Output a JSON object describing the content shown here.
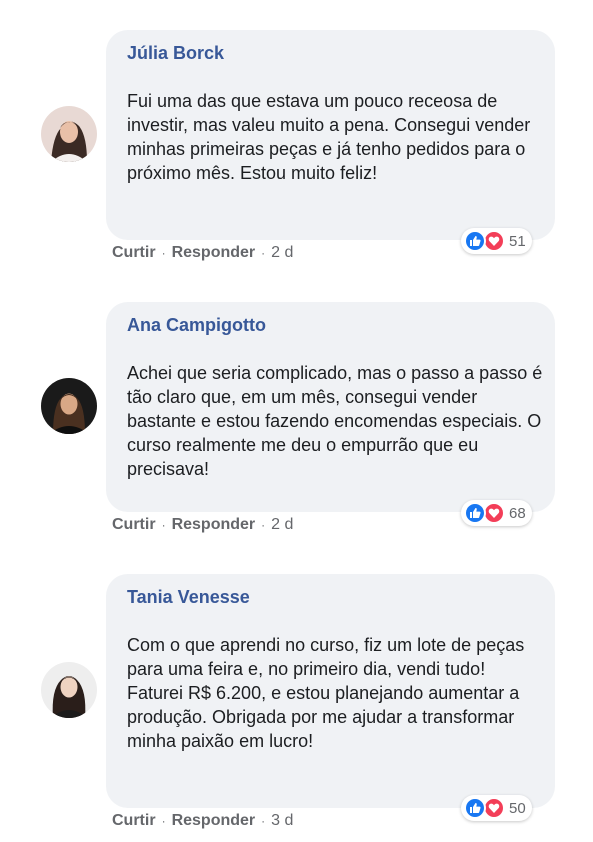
{
  "comments": [
    {
      "author": "Júlia Borck",
      "text": "Fui uma das que estava um pouco receosa de investir, mas valeu muito a pena. Consegui vender minhas primeiras peças e já tenho pedidos para o próximo mês. Estou muito feliz!",
      "reaction_count": "51",
      "like_label": "Curtir",
      "reply_label": "Responder",
      "time": "2 d"
    },
    {
      "author": "Ana Campigotto",
      "text": "Achei que seria complicado, mas o passo a passo é tão claro que, em um mês, consegui vender bastante e estou fazendo encomendas especiais. O curso realmente me deu o empurrão que eu precisava!",
      "reaction_count": "68",
      "like_label": "Curtir",
      "reply_label": "Responder",
      "time": "2 d"
    },
    {
      "author": "Tania Venesse",
      "text": "Com o que aprendi no curso, fiz um lote de peças para uma feira e, no primeiro dia, vendi tudo! Faturei R$ 6.200, e estou planejando aumentar a produção. Obrigada por me ajudar a transformar minha paixão em lucro!",
      "reaction_count": "50",
      "like_label": "Curtir",
      "reply_label": "Responder",
      "time": "3 d"
    }
  ],
  "separator": "·",
  "icons": {
    "like": "thumbs-up-icon",
    "love": "heart-icon"
  },
  "colors": {
    "author": "#385898",
    "bubble": "#f0f2f5",
    "like": "#1877f2",
    "love": "#f33e58",
    "meta": "#65676b"
  }
}
